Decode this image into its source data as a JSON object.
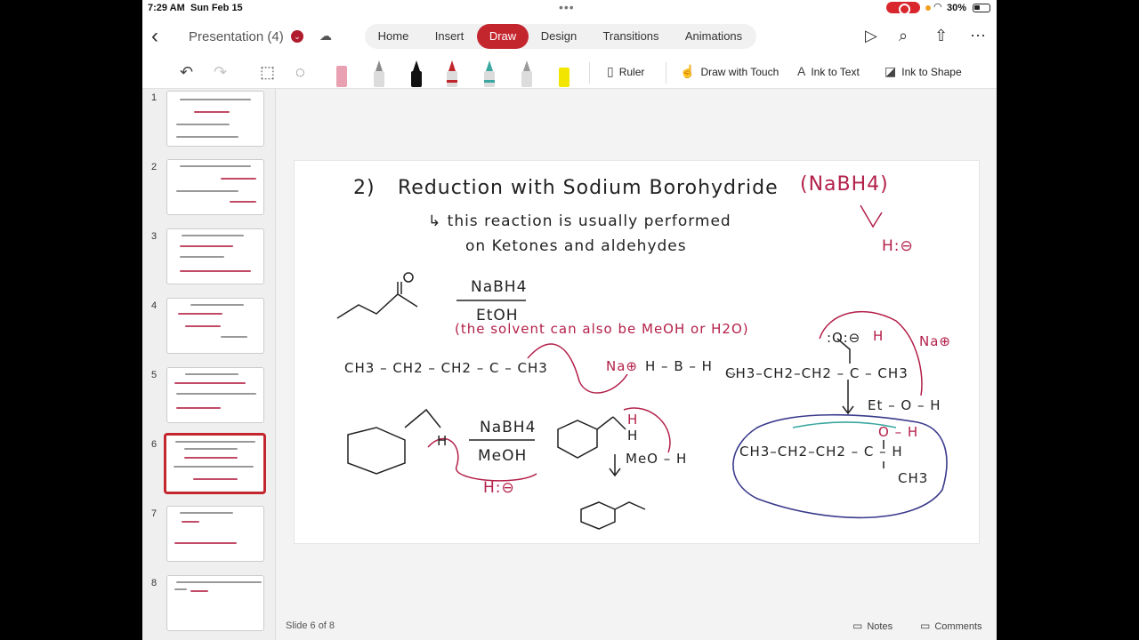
{
  "status_bar": {
    "time": "7:29 AM",
    "date": "Sun Feb 15",
    "battery": "30%"
  },
  "title_bar": {
    "doc_title": "Presentation (4)",
    "tabs": [
      {
        "label": "Home"
      },
      {
        "label": "Insert"
      },
      {
        "label": "Draw",
        "active": true
      },
      {
        "label": "Design"
      },
      {
        "label": "Transitions"
      },
      {
        "label": "Animations"
      }
    ],
    "icons": [
      "back-icon",
      "cloud-icon",
      "play-icon",
      "search-icon",
      "share-icon",
      "more-icon"
    ]
  },
  "toolbar": {
    "ruler": "Ruler",
    "draw_with_touch": "Draw with Touch",
    "ink_to_text": "Ink to Text",
    "ink_to_shape": "Ink to Shape",
    "pen_colors": [
      "#e9a0b0",
      "#8a8a8a",
      "#111111",
      "#c0252c",
      "#3aa7a0",
      "#9a9a9a",
      "#f2e600"
    ]
  },
  "thumbnails": [
    "1",
    "2",
    "3",
    "4",
    "5",
    "6",
    "7",
    "8"
  ],
  "selected_slide": 6,
  "footer": {
    "slide_count": "Slide 6 of 8",
    "notes": "Notes",
    "comments": "Comments"
  },
  "slide": {
    "heading_num": "2)",
    "heading": "Reduction with Sodium Borohydride",
    "heading_reagent": "(NaBH4)",
    "note_line1": "↳ this reaction is usually performed",
    "note_line2": "on Ketones and aldehydes",
    "hydride": "H:⊖",
    "reagent1": "NaBH4",
    "solvent1": "EtOH",
    "solvent_note": "(the solvent can also be MeOH or H2O)",
    "chain_left": "CH3 – CH2 – CH2 – C – CH3",
    "na_plus": "Na⊕",
    "borohydride": "H – B – H",
    "chain_right": "CH3–CH2–CH2 – C – CH3",
    "na_plus2": "Na⊕",
    "ethanol": "Et – O – H",
    "product": "CH3–CH2–CH2 – C – H",
    "product_oh": "O – H",
    "product_ch3": "CH3",
    "aldehyde_h": "H",
    "reagent2": "NaBH4",
    "solvent2": "MeOH",
    "hydride2": "H:⊖",
    "intermediate_h1": "H",
    "intermediate_h2": "H",
    "methanol": "MeO – H",
    "oxide": ":O:⊖",
    "h_top": "H"
  }
}
